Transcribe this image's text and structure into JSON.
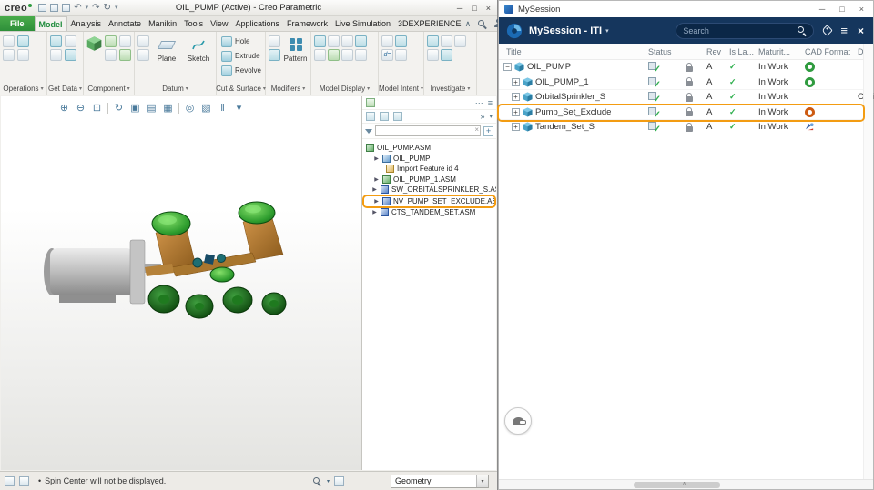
{
  "icons": {
    "minimize": "─",
    "maximize": "□",
    "close": "×",
    "plus": "+",
    "minus": "−",
    "chevron_down": "▾",
    "chevron_up": "∧",
    "expander": "▶",
    "check": "✓",
    "bullet": "•",
    "menu": "≡",
    "more": "»",
    "dots": "⋯",
    "undo": "↶",
    "redo": "↷",
    "regenerate": "↻",
    "relations": "d="
  },
  "colors": {
    "highlight_orange": "#F39C12",
    "creo_green": "#2F9B3F",
    "header_navy": "#15365D",
    "status_green": "#2EAF4D"
  },
  "creo": {
    "titlebar": {
      "logo_text": "creo",
      "title": "OIL_PUMP (Active) - Creo Parametric"
    },
    "tabs": [
      "File",
      "Model",
      "Analysis",
      "Annotate",
      "Manikin",
      "Tools",
      "View",
      "Applications",
      "Framework",
      "Live Simulation",
      "3DEXPERIENCE"
    ],
    "active_tab": "Model",
    "ribbon": {
      "groups": [
        "Operations",
        "Get Data",
        "Component",
        "Datum",
        "Cut & Surface",
        "Modifiers",
        "Model Display",
        "Model Intent",
        "Investigate"
      ],
      "buttons": {
        "plane": "Plane",
        "sketch": "Sketch",
        "hole": "Hole",
        "extrude": "Extrude",
        "revolve": "Revolve",
        "pattern": "Pattern"
      }
    },
    "graphics_toolbar": [
      "⊕",
      "⊖",
      "⊡",
      "↻",
      "▣",
      "▤",
      "▦",
      "◎",
      "▧",
      "‖",
      "▾"
    ],
    "tree": {
      "items": [
        {
          "label": "OIL_PUMP.ASM"
        },
        {
          "label": "OIL_PUMP"
        },
        {
          "label": "Import Feature id 4"
        },
        {
          "label": "OIL_PUMP_1.ASM"
        },
        {
          "label": "SW_ORBITALSPRINKLER_S.ASM"
        },
        {
          "label": "NV_PUMP_SET_EXCLUDE.ASM",
          "highlighted": true
        },
        {
          "label": "CTS_TANDEM_SET.ASM"
        }
      ]
    },
    "statusbar": {
      "message": "Spin Center will not be displayed.",
      "filter_label": "Geometry"
    }
  },
  "mysession": {
    "window_title": "MySession",
    "header": {
      "app_title": "MySession - ITI",
      "search_placeholder": "Search"
    },
    "table": {
      "columns": [
        "Title",
        "Status",
        "Rev",
        "Is La...",
        "Maturit...",
        "CAD Format",
        "Des"
      ],
      "rows": [
        {
          "title": "OIL_PUMP",
          "rev": "A",
          "maturity": "In Work",
          "cad": "creo",
          "des": ""
        },
        {
          "title": "OIL_PUMP_1",
          "rev": "A",
          "maturity": "In Work",
          "cad": "creo",
          "des": ""
        },
        {
          "title": "OrbitalSprinkler_S",
          "rev": "A",
          "maturity": "In Work",
          "cad": "",
          "des": "Orbi"
        },
        {
          "title": "Pump_Set_Exclude",
          "rev": "A",
          "maturity": "In Work",
          "cad": "creo-excluded",
          "des": "",
          "highlighted": true
        },
        {
          "title": "Tandem_Set_S",
          "rev": "A",
          "maturity": "In Work",
          "cad": "catia",
          "des": ""
        }
      ]
    }
  }
}
